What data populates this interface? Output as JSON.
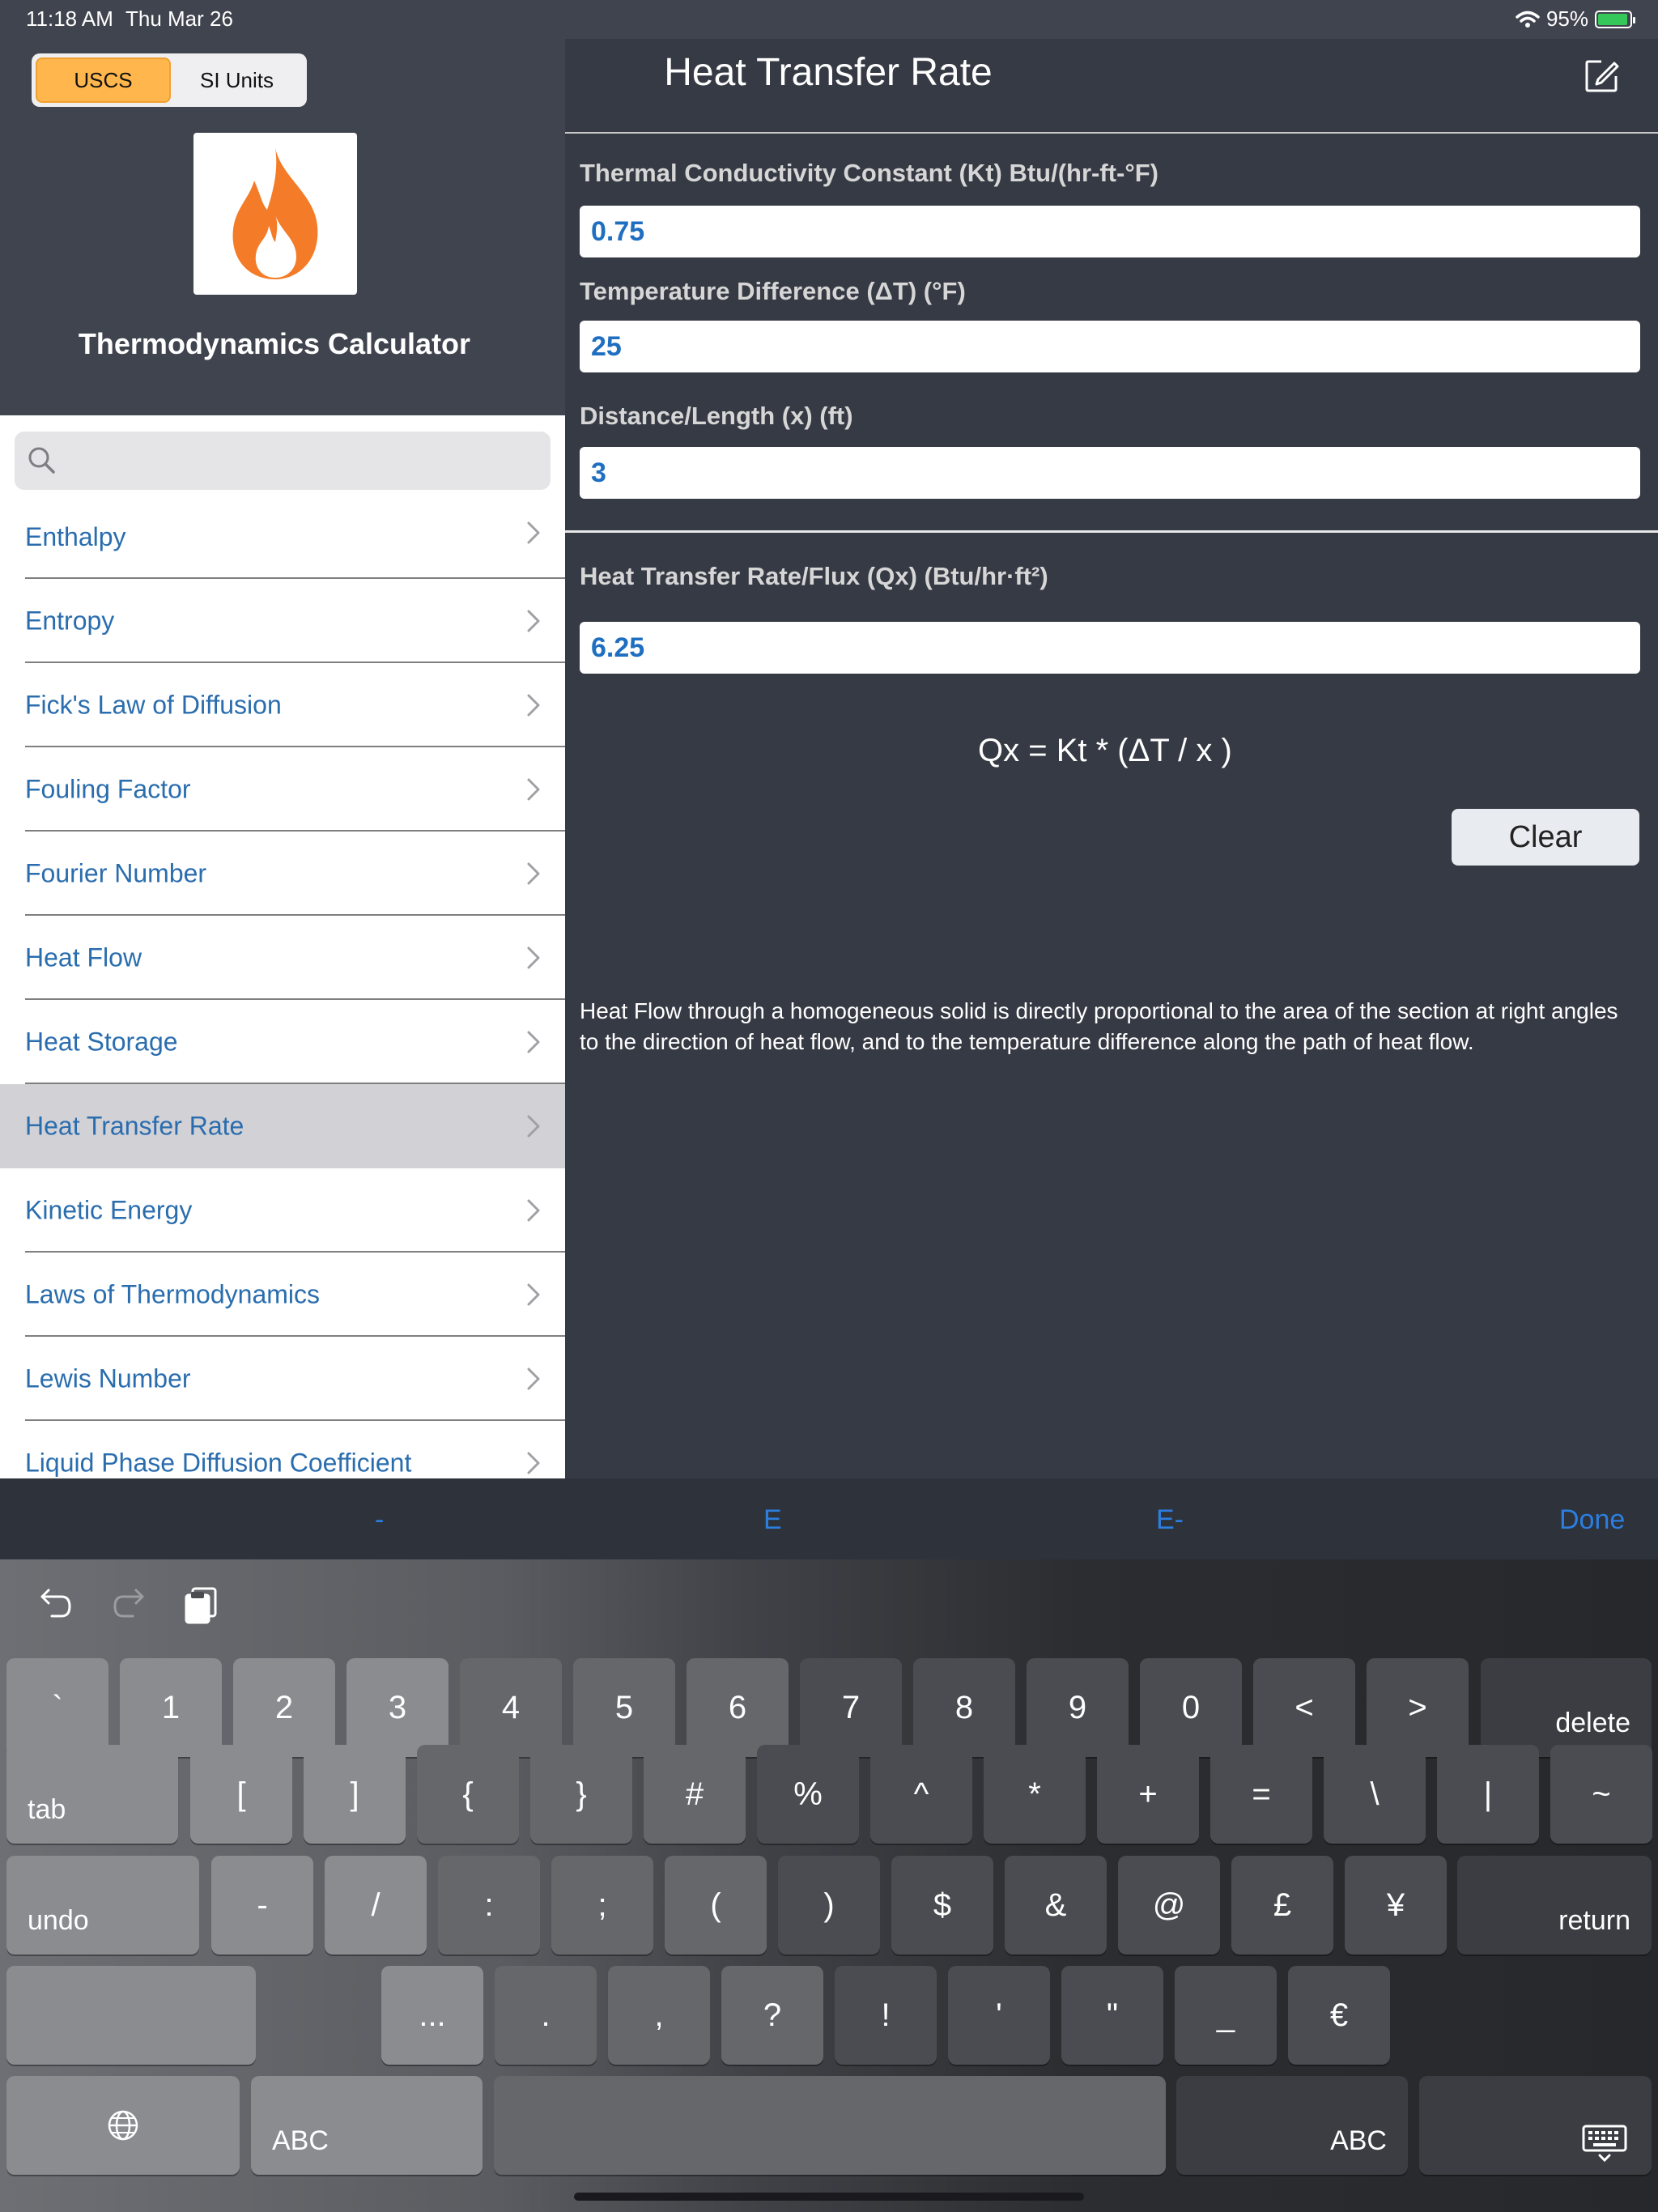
{
  "status_bar": {
    "time": "11:18 AM",
    "date": "Thu Mar 26",
    "battery": "95%"
  },
  "units": {
    "options": [
      "USCS",
      "SI Units"
    ],
    "selected": "USCS"
  },
  "app": {
    "title": "Thermodynamics Calculator"
  },
  "search": {
    "placeholder": ""
  },
  "sidebar": {
    "items": [
      {
        "label": "Enthalpy"
      },
      {
        "label": "Entropy"
      },
      {
        "label": "Fick's Law of Diffusion"
      },
      {
        "label": "Fouling Factor"
      },
      {
        "label": "Fourier Number"
      },
      {
        "label": "Heat Flow"
      },
      {
        "label": "Heat Storage"
      },
      {
        "label": "Heat Transfer Rate",
        "selected": true
      },
      {
        "label": "Kinetic Energy"
      },
      {
        "label": "Laws of Thermodynamics"
      },
      {
        "label": "Lewis Number"
      },
      {
        "label": "Liquid Phase Diffusion Coefficient"
      }
    ]
  },
  "main": {
    "title": "Heat Transfer Rate",
    "fields": [
      {
        "label": "Thermal Conductivity Constant (Kt)  Btu/(hr-ft-°F)",
        "value": "0.75"
      },
      {
        "label": "Temperature Difference (ΔT) (°F)",
        "value": "25"
      },
      {
        "label": "Distance/Length (x) (ft)",
        "value": "3"
      }
    ],
    "result": {
      "label": "Heat Transfer Rate/Flux (Qx) (Btu/hr·ft²)",
      "value": "6.25"
    },
    "formula": "Qx = Kt * (ΔT / x )",
    "clear_label": "Clear",
    "description": "Heat Flow through a homogeneous solid is directly proportional to the area of the section at right angles to the direction of heat flow, and to the temperature difference along the path of heat flow."
  },
  "accessory": {
    "minus": "-",
    "e": "E",
    "e_minus": "E-",
    "done": "Done"
  },
  "keyboard": {
    "row1": [
      "`",
      "1",
      "2",
      "3",
      "4",
      "5",
      "6",
      "7",
      "8",
      "9",
      "0",
      "<",
      ">"
    ],
    "delete": "delete",
    "tab": "tab",
    "row2": [
      "[",
      "]",
      "{",
      "}",
      "#",
      "%",
      "^",
      "*",
      "+",
      "=",
      "\\",
      "|",
      "~"
    ],
    "undo": "undo",
    "row3": [
      "-",
      "/",
      ":",
      ";",
      "(",
      ")",
      "$",
      "&",
      "@",
      "£",
      "¥"
    ],
    "return": "return",
    "redo": "redo",
    "row4": [
      "...",
      ".",
      ",",
      "?",
      "!",
      "'",
      "\"",
      "_",
      "€"
    ],
    "abc": "ABC",
    "accent": "#2c7ee0"
  },
  "colors": {
    "link": "#2a6dae",
    "accent_orange": "#ffb74d",
    "value_blue": "#1f6fc0",
    "background": "#363a44"
  }
}
